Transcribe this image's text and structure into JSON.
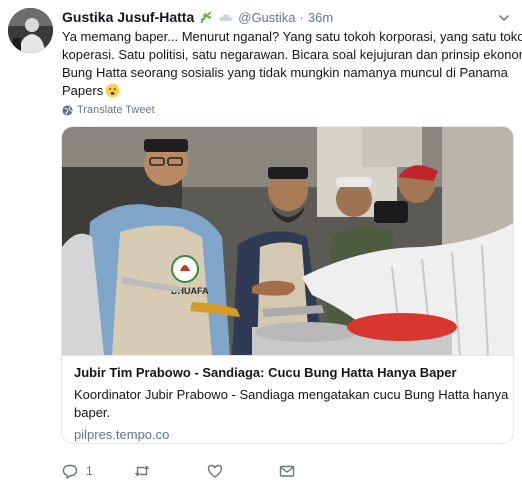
{
  "tweet": {
    "display_name": "Gustika Jusuf-Hatta",
    "handle": "@Gustika",
    "separator": "·",
    "time": "36m",
    "text_lines": [
      "Ya memang baper... Menurut nganal? Yang satu tokoh korporasi, yang satu tokoh",
      "koperasi. Satu politisi, satu negarawan. Bicara soal kejujuran dan prinsip ekonomi,",
      "Bung Hatta seorang sosialis yang tidak mungkin namanya muncul di Panama",
      "Papers"
    ],
    "translate_label": "Translate Tweet"
  },
  "card": {
    "title": "Jubir Tim Prabowo - Sandiaga: Cucu Bung Hatta Hanya Baper",
    "description_lines": [
      "Koordinator Jubir Prabowo - Sandiaga mengatakan cucu Bung Hatta hanya",
      "baper."
    ],
    "domain": "pilpres.tempo.co",
    "apron_logo_text": "DHUAFA"
  },
  "actions": {
    "reply_count": "1",
    "retweet_count": "",
    "like_count": ""
  },
  "icons": {
    "name_badges": [
      "herb-emoji-icon",
      "cloud-emoji-icon"
    ],
    "inline_emoji": "worried-face-emoji-icon",
    "caret": "chevron-down-icon",
    "translate": "globe-icon",
    "reply": "reply-icon",
    "retweet": "retweet-icon",
    "like": "heart-icon",
    "dm": "envelope-icon"
  },
  "colors": {
    "text": "#14171a",
    "secondary": "#657786",
    "border": "#e1e8ed"
  }
}
